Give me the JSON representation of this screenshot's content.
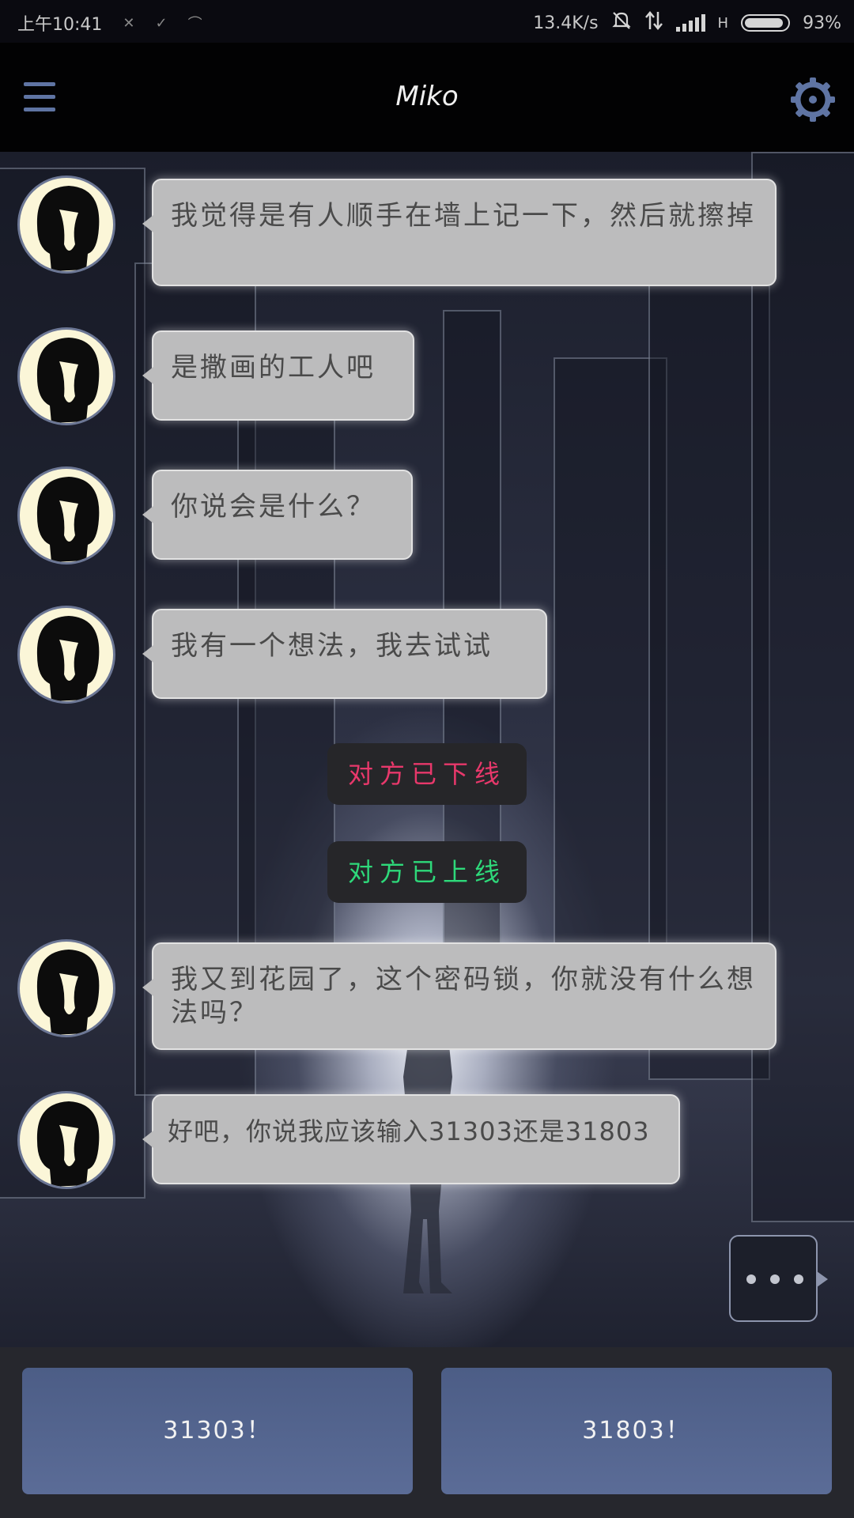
{
  "status_bar": {
    "time": "上午10:41",
    "notif_icons": [
      "x-icon",
      "check-icon",
      "curve-icon"
    ],
    "net_speed": "13.4K/s",
    "network_type": "H",
    "battery": "93%",
    "battery_level": 0.93
  },
  "header": {
    "title": "Miko",
    "menu_icon": "hamburger-icon",
    "settings_icon": "gear-icon"
  },
  "colors": {
    "bubble_bg": "#bcbcbd",
    "offline_text": "#e8386b",
    "online_text": "#2ed97a",
    "choice_bg": "#556795",
    "accent_icon": "#5f74a3"
  },
  "messages": [
    {
      "text": "我觉得是有人顺手在墙上记一下，然后就擦掉"
    },
    {
      "text": "是撒画的工人吧"
    },
    {
      "text": "你说会是什么？"
    },
    {
      "text": "我有一个想法，我去试试"
    },
    {
      "text": "我又到花园了，这个密码锁，你就没有什么想法吗？"
    },
    {
      "text": "好吧，你说我应该输入31303还是31803"
    }
  ],
  "system_messages": {
    "offline": "对方已下线",
    "online": "对方已上线"
  },
  "typing_indicator": "more-dots-icon",
  "choices": [
    {
      "label": "31303！"
    },
    {
      "label": "31803！"
    }
  ]
}
